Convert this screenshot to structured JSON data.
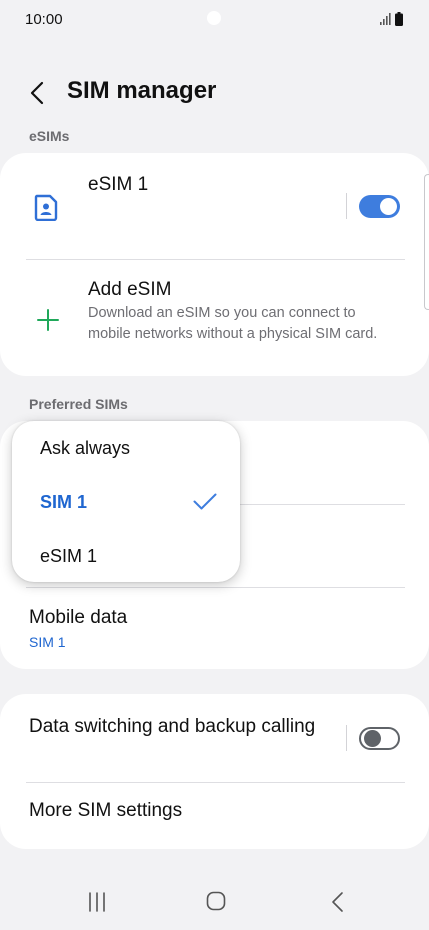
{
  "status_bar": {
    "time": "10:00"
  },
  "header": {
    "title": "SIM manager"
  },
  "sections": {
    "esims_label": "eSIMs",
    "preferred_label": "Preferred SIMs"
  },
  "esim_card": {
    "esim1": {
      "title": "eSIM 1",
      "enabled": true
    },
    "add_esim": {
      "title": "Add eSIM",
      "description": "Download an eSIM so you can connect to mobile networks without a physical SIM card."
    }
  },
  "preferred_card": {
    "mobile_data": {
      "title": "Mobile data",
      "value": "SIM 1"
    }
  },
  "dropdown": {
    "options": [
      "Ask always",
      "SIM 1",
      "eSIM 1"
    ],
    "selected": "SIM 1"
  },
  "bottom_card": {
    "data_switching": {
      "title": "Data switching and backup calling",
      "enabled": false
    },
    "more_settings": {
      "title": "More SIM settings"
    }
  },
  "colors": {
    "accent": "#3e7dde",
    "selected_text": "#1f66d0",
    "add_icon": "#1fa85a",
    "background": "#f2f2f4"
  }
}
